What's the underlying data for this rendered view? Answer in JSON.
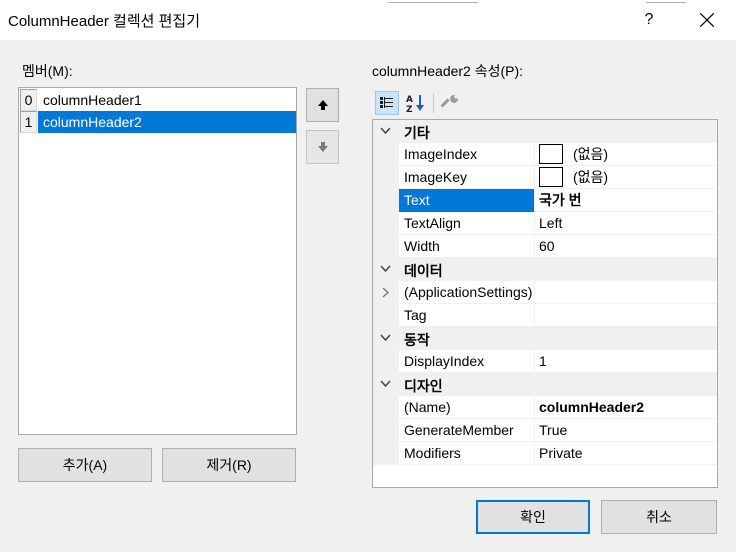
{
  "window": {
    "title": "ColumnHeader 컬렉션 편집기",
    "help_glyph": "?"
  },
  "members": {
    "label": "멤버(M):",
    "items": [
      {
        "index": "0",
        "name": "columnHeader1",
        "selected": false
      },
      {
        "index": "1",
        "name": "columnHeader2",
        "selected": true
      }
    ],
    "add_label": "추가(A)",
    "remove_label": "제거(R)"
  },
  "properties": {
    "label": "columnHeader2 속성(P):",
    "toolbar": {
      "categorized_icon": "categorized-icon",
      "alphabetical_icon": "alphabetical-icon",
      "property_pages_icon": "property-pages-icon"
    },
    "categories": [
      {
        "name": "기타",
        "rows": [
          {
            "name": "ImageIndex",
            "value": "(없음)",
            "swatch": true
          },
          {
            "name": "ImageKey",
            "value": "(없음)",
            "swatch": true
          },
          {
            "name": "Text",
            "value": "국가 번",
            "selected": true,
            "bold": true
          },
          {
            "name": "TextAlign",
            "value": "Left"
          },
          {
            "name": "Width",
            "value": "60"
          }
        ]
      },
      {
        "name": "데이터",
        "rows": [
          {
            "name": "(ApplicationSettings)",
            "value": "",
            "expandable": true
          },
          {
            "name": "Tag",
            "value": ""
          }
        ]
      },
      {
        "name": "동작",
        "rows": [
          {
            "name": "DisplayIndex",
            "value": "1"
          }
        ]
      },
      {
        "name": "디자인",
        "rows": [
          {
            "name": "(Name)",
            "value": "columnHeader2",
            "bold": true
          },
          {
            "name": "GenerateMember",
            "value": "True"
          },
          {
            "name": "Modifiers",
            "value": "Private"
          }
        ]
      }
    ]
  },
  "buttons": {
    "ok_label": "확인",
    "cancel_label": "취소"
  },
  "colors": {
    "selection": "#0078d7",
    "window_bg": "#f0f0f0"
  }
}
